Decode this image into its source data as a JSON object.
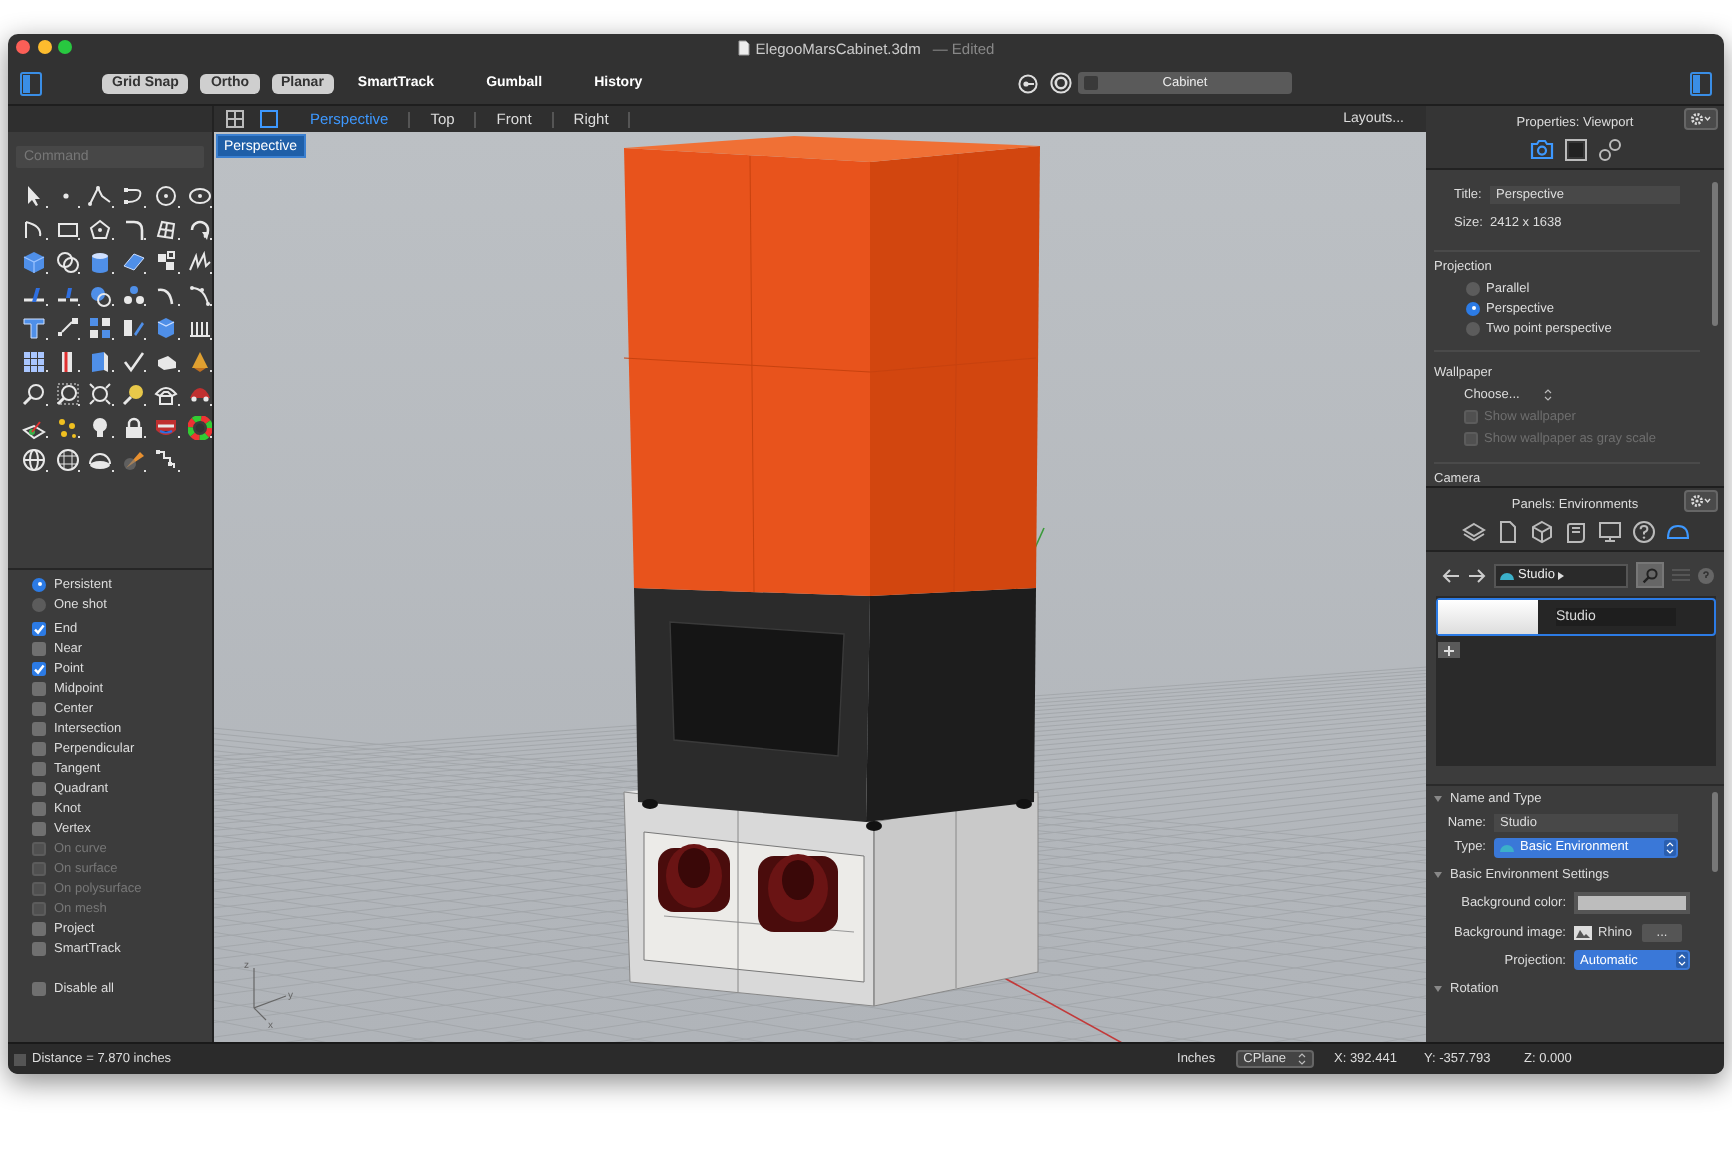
{
  "window": {
    "title": "ElegooMarsCabinet.3dm",
    "status": "— Edited"
  },
  "toolbar": {
    "toggles": [
      {
        "label": "Grid Snap",
        "on": true
      },
      {
        "label": "Ortho",
        "on": true
      },
      {
        "label": "Planar",
        "on": true
      },
      {
        "label": "SmartTrack",
        "on": false
      },
      {
        "label": "Gumball",
        "on": false
      },
      {
        "label": "History",
        "on": false
      }
    ],
    "layer": "Cabinet"
  },
  "command": {
    "placeholder": "Command"
  },
  "osnap_modes": [
    {
      "label": "Persistent",
      "selected": true
    },
    {
      "label": "One shot",
      "selected": false
    }
  ],
  "osnaps": [
    {
      "label": "End",
      "checked": true,
      "disabled": false
    },
    {
      "label": "Near",
      "checked": false,
      "disabled": false
    },
    {
      "label": "Point",
      "checked": true,
      "disabled": false
    },
    {
      "label": "Midpoint",
      "checked": false,
      "disabled": false
    },
    {
      "label": "Center",
      "checked": false,
      "disabled": false
    },
    {
      "label": "Intersection",
      "checked": false,
      "disabled": false
    },
    {
      "label": "Perpendicular",
      "checked": false,
      "disabled": false
    },
    {
      "label": "Tangent",
      "checked": false,
      "disabled": false
    },
    {
      "label": "Quadrant",
      "checked": false,
      "disabled": false
    },
    {
      "label": "Knot",
      "checked": false,
      "disabled": false
    },
    {
      "label": "Vertex",
      "checked": false,
      "disabled": false
    },
    {
      "label": "On curve",
      "checked": false,
      "disabled": true
    },
    {
      "label": "On surface",
      "checked": false,
      "disabled": true
    },
    {
      "label": "On polysurface",
      "checked": false,
      "disabled": true
    },
    {
      "label": "On mesh",
      "checked": false,
      "disabled": true
    },
    {
      "label": "Project",
      "checked": false,
      "disabled": false
    },
    {
      "label": "SmartTrack",
      "checked": false,
      "disabled": false
    }
  ],
  "disable_all": {
    "label": "Disable all",
    "checked": false
  },
  "viewport_tabs": [
    {
      "label": "Perspective",
      "selected": true
    },
    {
      "label": "Top",
      "selected": false
    },
    {
      "label": "Front",
      "selected": false
    },
    {
      "label": "Right",
      "selected": false
    }
  ],
  "layouts": "Layouts...",
  "viewport": {
    "label": "Perspective",
    "axis_labels": [
      "z",
      "x",
      "y"
    ]
  },
  "properties": {
    "title": "Properties: Viewport",
    "tabs": [
      {
        "kind": "camera",
        "selected": true
      },
      {
        "kind": "display",
        "selected": false
      },
      {
        "kind": "link",
        "selected": false
      }
    ],
    "fields": [
      {
        "kind": "input",
        "label": "Title:",
        "value": "Perspective"
      },
      {
        "kind": "text",
        "label": "Size:",
        "value": "2412 x 1638"
      }
    ],
    "projection": {
      "heading": "Projection",
      "options": [
        {
          "label": "Parallel",
          "selected": false
        },
        {
          "label": "Perspective",
          "selected": true
        },
        {
          "label": "Two point perspective",
          "selected": false
        }
      ]
    },
    "wallpaper": {
      "heading": "Wallpaper",
      "choose": "Choose...",
      "options": [
        {
          "label": "Show wallpaper",
          "checked": false,
          "disabled": true
        },
        {
          "label": "Show wallpaper as gray scale",
          "checked": false,
          "disabled": true
        }
      ]
    },
    "camera": {
      "heading": "Camera"
    }
  },
  "environments": {
    "title": "Panels: Environments",
    "tabs": [
      {
        "kind": "layers",
        "selected": false
      },
      {
        "kind": "page",
        "selected": false
      },
      {
        "kind": "cube",
        "selected": false
      },
      {
        "kind": "scroll",
        "selected": false
      },
      {
        "kind": "monitor",
        "selected": false
      },
      {
        "kind": "help",
        "selected": false
      },
      {
        "kind": "cloud",
        "selected": true
      }
    ],
    "breadcrumb": "Studio",
    "items": [
      {
        "name": "Studio",
        "selected": true
      }
    ],
    "name_and_type": {
      "heading": "Name and Type",
      "name_label": "Name:",
      "name": "Studio",
      "type_label": "Type:",
      "type": "Basic Environment"
    },
    "settings": {
      "heading": "Basic Environment Settings",
      "background_color_label": "Background color:",
      "background_image_label": "Background image:",
      "background_image": "Rhino",
      "browse": "...",
      "projection_label": "Projection:",
      "projection": "Automatic"
    },
    "rotation": {
      "heading": "Rotation"
    }
  },
  "status_bar": {
    "distance": "Distance = 7.870 inches",
    "units": "Inches",
    "cplane": "CPlane",
    "x": "X: 392.441",
    "y": "Y: -357.793",
    "z": "Z: 0.000"
  }
}
